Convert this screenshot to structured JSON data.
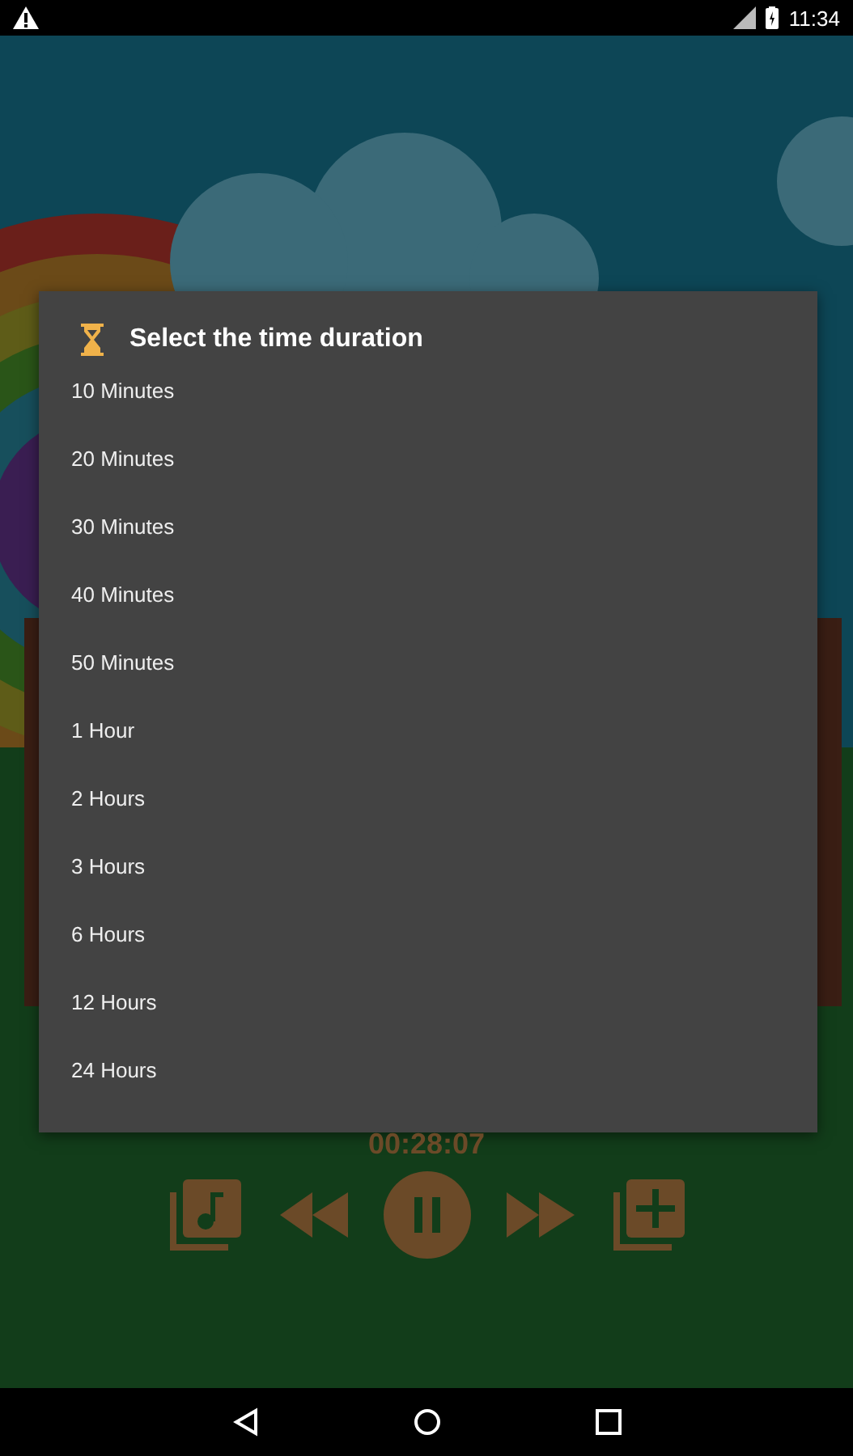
{
  "status_bar": {
    "time": "11:34"
  },
  "dialog": {
    "title": "Select the time duration",
    "options": [
      "10 Minutes",
      "20 Minutes",
      "30 Minutes",
      "40 Minutes",
      "50 Minutes",
      "1 Hour",
      "2 Hours",
      "3 Hours",
      "6 Hours",
      "12 Hours",
      "24 Hours"
    ]
  },
  "player": {
    "elapsed": "00:28:07",
    "playing": true
  }
}
